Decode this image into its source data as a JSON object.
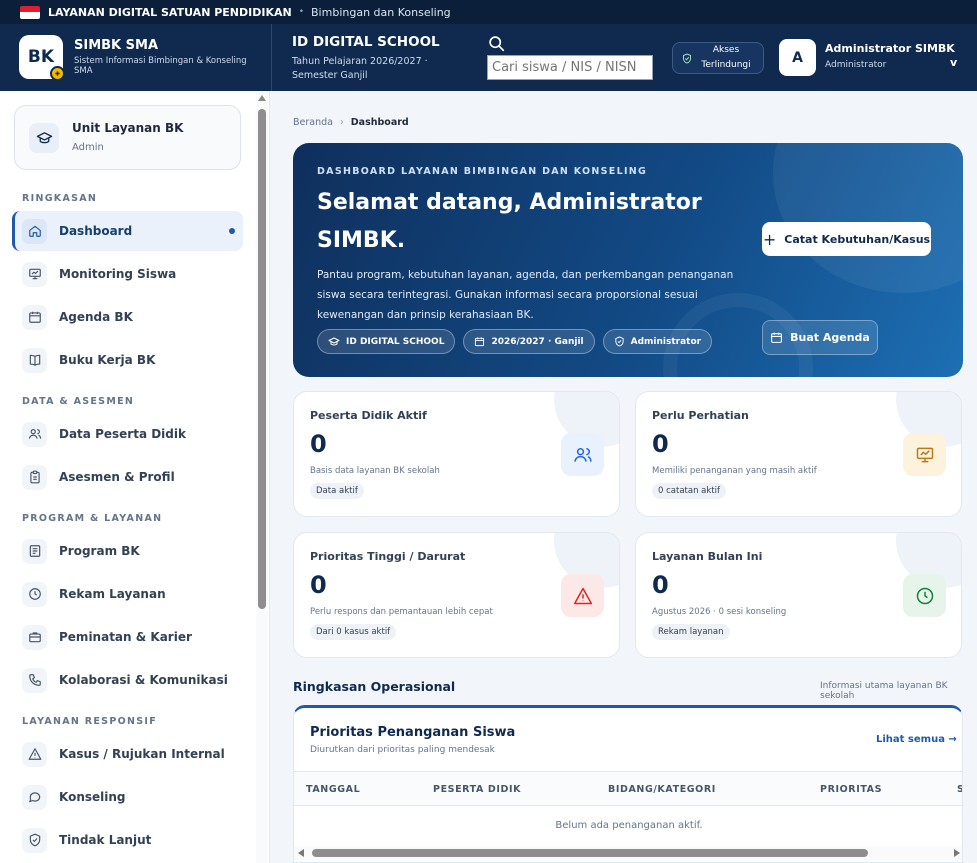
{
  "topbar": {
    "title": "LAYANAN DIGITAL SATUAN PENDIDIKAN",
    "separator": "•",
    "subtitle": "Bimbingan dan Konseling"
  },
  "header": {
    "logo_text": "BK",
    "app_title": "SIMBK SMA",
    "app_subtitle": "Sistem Informasi Bimbingan & Konseling SMA",
    "school_name": "ID DIGITAL SCHOOL",
    "school_period": "Tahun Pelajaran 2026/2027 · Semester Ganjil",
    "search_placeholder": "Cari siswa / NIS / NISN",
    "access_label": "Akses Terlindungi",
    "user_initial": "A",
    "user_name": "Administrator SIMBK",
    "user_role": "Administrator",
    "user_caret": "v"
  },
  "sidebar": {
    "unit_title": "Unit Layanan BK",
    "unit_role": "Admin",
    "sections": {
      "ringkasan": "RINGKASAN",
      "data": "DATA & ASESMEN",
      "program": "PROGRAM & LAYANAN",
      "responsif": "LAYANAN RESPONSIF"
    },
    "items": [
      {
        "label": "Dashboard",
        "icon": "home-icon"
      },
      {
        "label": "Monitoring Siswa",
        "icon": "monitor-icon"
      },
      {
        "label": "Agenda BK",
        "icon": "calendar-icon"
      },
      {
        "label": "Buku Kerja BK",
        "icon": "book-icon"
      },
      {
        "label": "Data Peserta Didik",
        "icon": "users-icon"
      },
      {
        "label": "Asesmen & Profil",
        "icon": "clipboard-icon"
      },
      {
        "label": "Program BK",
        "icon": "document-icon"
      },
      {
        "label": "Rekam Layanan",
        "icon": "clock-icon"
      },
      {
        "label": "Peminatan & Karier",
        "icon": "briefcase-icon"
      },
      {
        "label": "Kolaborasi & Komunikasi",
        "icon": "phone-icon"
      },
      {
        "label": "Kasus / Rujukan Internal",
        "icon": "warning-icon"
      },
      {
        "label": "Konseling",
        "icon": "chat-icon"
      },
      {
        "label": "Tindak Lanjut",
        "icon": "shield-check-icon"
      }
    ]
  },
  "breadcrumb": {
    "home": "Beranda",
    "separator": "›",
    "current": "Dashboard"
  },
  "hero": {
    "kicker": "DASHBOARD LAYANAN BIMBINGAN DAN KONSELING",
    "title": "Selamat datang, Administrator SIMBK.",
    "description": "Pantau program, kebutuhan layanan, agenda, dan perkembangan penanganan siswa secara terintegrasi. Gunakan informasi secara proporsional sesuai kewenangan dan prinsip kerahasiaan BK.",
    "chips": [
      "ID DIGITAL SCHOOL",
      "2026/2027 · Ganjil",
      "Administrator"
    ],
    "primary_button": "Catat Kebutuhan/Kasus",
    "primary_button_icon": "+",
    "secondary_button": "Buat Agenda"
  },
  "stats": [
    {
      "title": "Peserta Didik Aktif",
      "value": "0",
      "subtitle": "Basis data layanan BK sekolah",
      "badge": "Data aktif",
      "icon": "users-icon",
      "color": "#2563eb",
      "bg": "#e8f1fc"
    },
    {
      "title": "Perlu Perhatian",
      "value": "0",
      "subtitle": "Memiliki penanganan yang masih aktif",
      "badge": "0 catatan aktif",
      "icon": "monitor-chart-icon",
      "color": "#b7791f",
      "bg": "#fdf3dc"
    },
    {
      "title": "Prioritas Tinggi / Darurat",
      "value": "0",
      "subtitle": "Perlu respons dan pemantauan lebih cepat",
      "badge": "Dari 0 kasus aktif",
      "icon": "warning-icon",
      "color": "#dc2626",
      "bg": "#fde8e8"
    },
    {
      "title": "Layanan Bulan Ini",
      "value": "0",
      "subtitle": "Agustus 2026 · 0 sesi konseling",
      "badge": "Rekam layanan",
      "icon": "clock-icon",
      "color": "#16803c",
      "bg": "#e6f4ea"
    }
  ],
  "operations": {
    "title": "Ringkasan Operasional",
    "subtitle": "Informasi utama layanan BK sekolah"
  },
  "priority_table": {
    "title": "Prioritas Penanganan Siswa",
    "subtitle": "Diurutkan dari prioritas paling mendesak",
    "link": "Lihat semua →",
    "columns": [
      "TANGGAL",
      "PESERTA DIDIK",
      "BIDANG/KATEGORI",
      "PRIORITAS",
      "S"
    ],
    "empty_message": "Belum ada penanganan aktif."
  }
}
